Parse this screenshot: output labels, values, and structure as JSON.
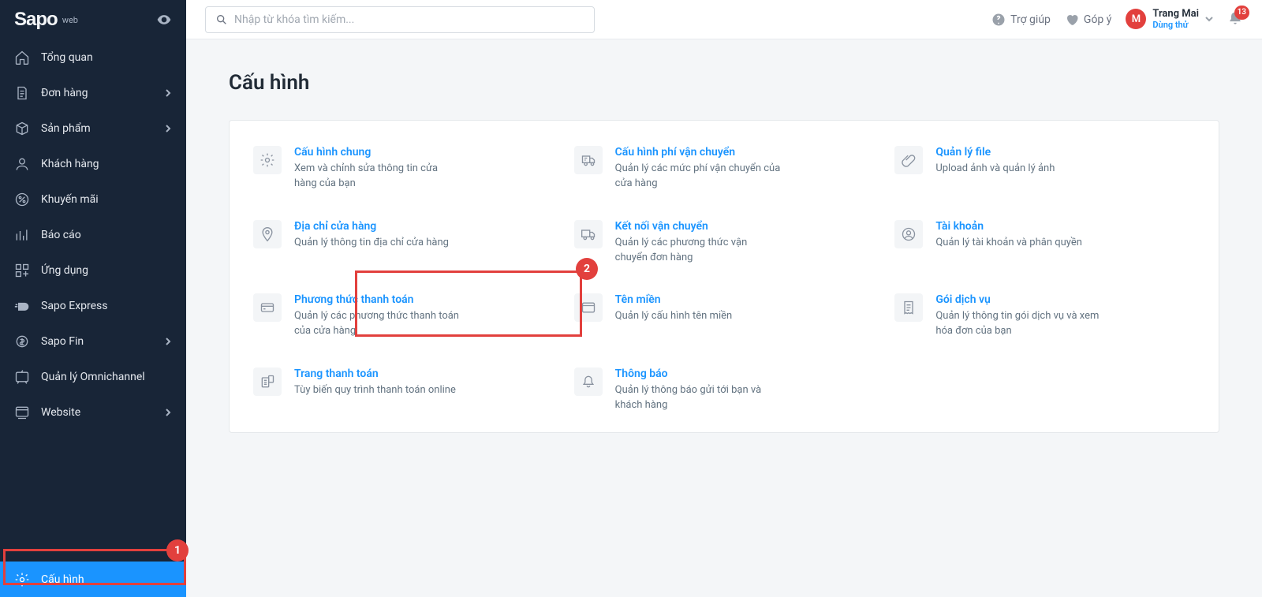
{
  "brand": {
    "name": "Sapo",
    "sub": "web"
  },
  "search": {
    "placeholder": "Nhập từ khóa tìm kiếm..."
  },
  "help": "Trợ giúp",
  "feedback": "Góp ý",
  "user": {
    "initial": "M",
    "name": "Trang Mai",
    "status": "Dùng thử"
  },
  "notif_count": "13",
  "sidebar": [
    {
      "label": "Tổng quan",
      "chev": false
    },
    {
      "label": "Đơn hàng",
      "chev": true
    },
    {
      "label": "Sản phẩm",
      "chev": true
    },
    {
      "label": "Khách hàng",
      "chev": false
    },
    {
      "label": "Khuyến mãi",
      "chev": false
    },
    {
      "label": "Báo cáo",
      "chev": false
    },
    {
      "label": "Ứng dụng",
      "chev": false
    },
    {
      "label": "Sapo Express",
      "chev": false
    },
    {
      "label": "Sapo Fin",
      "chev": true
    },
    {
      "label": "Quản lý Omnichannel",
      "chev": false
    },
    {
      "label": "Website",
      "chev": true
    }
  ],
  "sidebar_footer": {
    "label": "Cấu hình"
  },
  "page_title": "Cấu hình",
  "tiles": [
    {
      "title": "Cấu hình chung",
      "desc": "Xem và chỉnh sửa thông tin cửa hàng của bạn"
    },
    {
      "title": "Cấu hình phí vận chuyển",
      "desc": "Quản lý các mức phí vận chuyển của cửa hàng"
    },
    {
      "title": "Quản lý file",
      "desc": "Upload ảnh và quản lý ảnh"
    },
    {
      "title": "Địa chỉ cửa hàng",
      "desc": "Quản lý thông tin địa chỉ cửa hàng"
    },
    {
      "title": "Kết nối vận chuyển",
      "desc": "Quản lý các phương thức vận chuyển đơn hàng"
    },
    {
      "title": "Tài khoản",
      "desc": "Quản lý tài khoản và phân quyền"
    },
    {
      "title": "Phương thức thanh toán",
      "desc": "Quản lý các phương thức thanh toán của cửa hàng"
    },
    {
      "title": "Tên miền",
      "desc": "Quản lý cấu hình tên miền"
    },
    {
      "title": "Gói dịch vụ",
      "desc": "Quản lý thông tin gói dịch vụ và xem hóa đơn của bạn"
    },
    {
      "title": "Trang thanh toán",
      "desc": "Tùy biến quy trình thanh toán online"
    },
    {
      "title": "Thông báo",
      "desc": "Quản lý thông báo gửi tới bạn và khách hàng"
    }
  ],
  "annot": {
    "one": "1",
    "two": "2"
  }
}
